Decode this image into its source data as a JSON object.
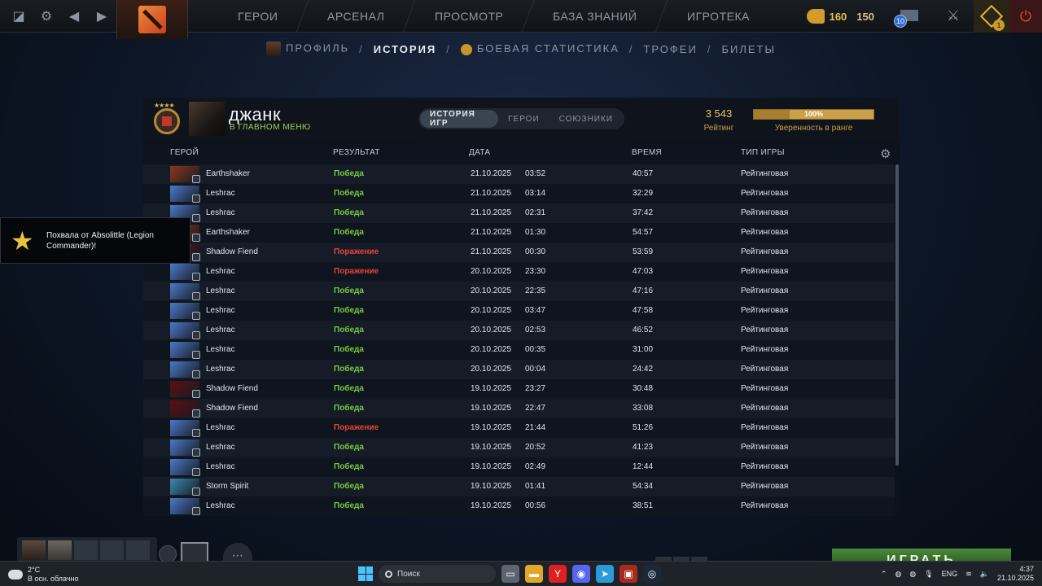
{
  "topbar": {
    "nav": [
      "ГЕРОИ",
      "АРСЕНАЛ",
      "ПРОСМОТР",
      "БАЗА ЗНАНИЙ",
      "ИГРОТЕКА"
    ],
    "shards": "160",
    "currency2": "150",
    "mail_count": "10",
    "quest_count": "1"
  },
  "subnav": {
    "items": [
      "ПРОФИЛЬ",
      "ИСТОРИЯ",
      "БОЕВАЯ СТАТИСТИКА",
      "ТРОФЕИ",
      "БИЛЕТЫ"
    ],
    "separator": "/"
  },
  "profile": {
    "name": "джанк",
    "status": "В ГЛАВНОМ МЕНЮ",
    "tabs": [
      "ИСТОРИЯ ИГР",
      "ГЕРОИ",
      "СОЮЗНИКИ"
    ],
    "rating_value": "3 543",
    "rating_label": "Рейтинг",
    "confidence_pct": "100%",
    "confidence_fraction": 1.0,
    "confidence_label": "Уверенность в ранге"
  },
  "columns": {
    "hero": "ГЕРОЙ",
    "result": "РЕЗУЛЬТАТ",
    "date": "ДАТА",
    "duration": "ВРЕМЯ",
    "type": "ТИП ИГРЫ"
  },
  "matches": [
    {
      "hero": "Earthshaker",
      "result": "Победа",
      "win": true,
      "date": "21.10.2025",
      "time": "03:52",
      "duration": "40:57",
      "type": "Рейтинговая"
    },
    {
      "hero": "Leshrac",
      "result": "Победа",
      "win": true,
      "date": "21.10.2025",
      "time": "03:14",
      "duration": "32:29",
      "type": "Рейтинговая"
    },
    {
      "hero": "Leshrac",
      "result": "Победа",
      "win": true,
      "date": "21.10.2025",
      "time": "02:31",
      "duration": "37:42",
      "type": "Рейтинговая"
    },
    {
      "hero": "Earthshaker",
      "result": "Победа",
      "win": true,
      "date": "21.10.2025",
      "time": "01:30",
      "duration": "54:57",
      "type": "Рейтинговая"
    },
    {
      "hero": "Shadow Fiend",
      "result": "Поражение",
      "win": false,
      "date": "21.10.2025",
      "time": "00:30",
      "duration": "53:59",
      "type": "Рейтинговая"
    },
    {
      "hero": "Leshrac",
      "result": "Поражение",
      "win": false,
      "date": "20.10.2025",
      "time": "23:30",
      "duration": "47:03",
      "type": "Рейтинговая"
    },
    {
      "hero": "Leshrac",
      "result": "Победа",
      "win": true,
      "date": "20.10.2025",
      "time": "22:35",
      "duration": "47:16",
      "type": "Рейтинговая"
    },
    {
      "hero": "Leshrac",
      "result": "Победа",
      "win": true,
      "date": "20.10.2025",
      "time": "03:47",
      "duration": "47:58",
      "type": "Рейтинговая"
    },
    {
      "hero": "Leshrac",
      "result": "Победа",
      "win": true,
      "date": "20.10.2025",
      "time": "02:53",
      "duration": "46:52",
      "type": "Рейтинговая"
    },
    {
      "hero": "Leshrac",
      "result": "Победа",
      "win": true,
      "date": "20.10.2025",
      "time": "00:35",
      "duration": "31:00",
      "type": "Рейтинговая"
    },
    {
      "hero": "Leshrac",
      "result": "Победа",
      "win": true,
      "date": "20.10.2025",
      "time": "00:04",
      "duration": "24:42",
      "type": "Рейтинговая"
    },
    {
      "hero": "Shadow Fiend",
      "result": "Победа",
      "win": true,
      "date": "19.10.2025",
      "time": "23:27",
      "duration": "30:48",
      "type": "Рейтинговая"
    },
    {
      "hero": "Shadow Fiend",
      "result": "Победа",
      "win": true,
      "date": "19.10.2025",
      "time": "22:47",
      "duration": "33:08",
      "type": "Рейтинговая"
    },
    {
      "hero": "Leshrac",
      "result": "Поражение",
      "win": false,
      "date": "19.10.2025",
      "time": "21:44",
      "duration": "51:26",
      "type": "Рейтинговая"
    },
    {
      "hero": "Leshrac",
      "result": "Победа",
      "win": true,
      "date": "19.10.2025",
      "time": "20:52",
      "duration": "41:23",
      "type": "Рейтинговая"
    },
    {
      "hero": "Leshrac",
      "result": "Победа",
      "win": true,
      "date": "19.10.2025",
      "time": "02:49",
      "duration": "12:44",
      "type": "Рейтинговая"
    },
    {
      "hero": "Storm Spirit",
      "result": "Победа",
      "win": true,
      "date": "19.10.2025",
      "time": "01:41",
      "duration": "54:34",
      "type": "Рейтинговая"
    },
    {
      "hero": "Leshrac",
      "result": "Победа",
      "win": true,
      "date": "19.10.2025",
      "time": "00:56",
      "duration": "38:51",
      "type": "Рейтинговая"
    }
  ],
  "hero_colors": {
    "Earthshaker": "#8a3a1a",
    "Leshrac": "#4a7ac8",
    "Shadow Fiend": "#5a1010",
    "Storm Spirit": "#3a8ab0"
  },
  "toast": {
    "text": "Похвала от Absolittle (Legion Commander)!"
  },
  "play_button": "ИГРАТЬ",
  "taskbar": {
    "weather_temp": "2°C",
    "weather_desc": "В осн. облачно",
    "search_placeholder": "Поиск",
    "lang": "ENG",
    "time": "4:37",
    "date": "21.10.2025"
  },
  "colors": {
    "win": "#78c840",
    "loss": "#e2443a",
    "accent_gold": "#e8c26a"
  }
}
